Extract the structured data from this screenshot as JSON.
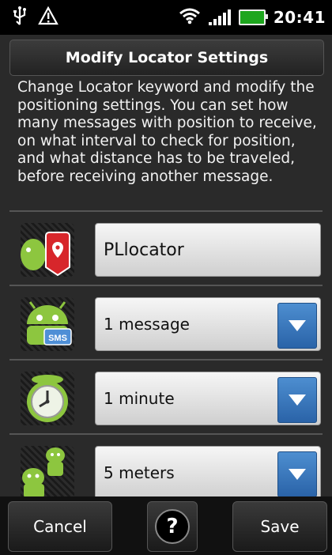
{
  "status_bar": {
    "time": "20:41",
    "icons": [
      "usb-icon",
      "warning-icon",
      "wifi-icon",
      "signal-icon",
      "battery-icon"
    ],
    "battery_color": "#1ea61e"
  },
  "dialog": {
    "title": "Modify Locator Settings",
    "description": "Change Locator keyword and modify the positioning settings. You can set how many messages with position to receive, on what interval to check for position, and what distance has to be traveled, before receiving another message."
  },
  "settings": {
    "keyword": {
      "icon": "locator-pin-icon",
      "value": "PLlocator"
    },
    "messages": {
      "icon": "sms-android-icon",
      "selected": "1 message"
    },
    "interval": {
      "icon": "clock-icon",
      "selected": "1 minute"
    },
    "distance": {
      "icon": "distance-androids-icon",
      "selected": "5 meters"
    }
  },
  "buttons": {
    "cancel": "Cancel",
    "help": "?",
    "save": "Save"
  },
  "colors": {
    "dropdown_accent": "#3a78bf",
    "android_green": "#8dc63f"
  }
}
